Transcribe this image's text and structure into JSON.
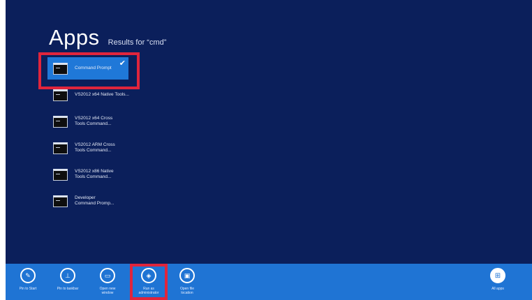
{
  "heading": {
    "title": "Apps",
    "subtitle": "Results for “cmd”"
  },
  "results": [
    {
      "label": "Command Prompt",
      "selected": true
    },
    {
      "label": "VS2012 x64 Native Tools...",
      "selected": false
    },
    {
      "label": "VS2012 x64 Cross\nTools Command...",
      "selected": false
    },
    {
      "label": "VS2012 ARM Cross\nTools Command...",
      "selected": false
    },
    {
      "label": "VS2012 x86 Native\nTools Command...",
      "selected": false
    },
    {
      "label": "Developer\nCommand Promp...",
      "selected": false
    }
  ],
  "app_bar": {
    "buttons": [
      {
        "label": "Pin to Start",
        "icon": "pin-icon"
      },
      {
        "label": "Pin to taskbar",
        "icon": "taskbar-icon"
      },
      {
        "label": "Open new\nwindow",
        "icon": "new-window-icon"
      },
      {
        "label": "Run as\nadministrator",
        "icon": "shield-icon"
      },
      {
        "label": "Open file\nlocation",
        "icon": "folder-icon"
      },
      {
        "label": "All apps",
        "icon": "all-apps-icon"
      }
    ]
  },
  "colors": {
    "background": "#0b1f5b",
    "selection": "#1f78d8",
    "app_bar": "#1f74d4",
    "highlight": "#e0253c"
  }
}
